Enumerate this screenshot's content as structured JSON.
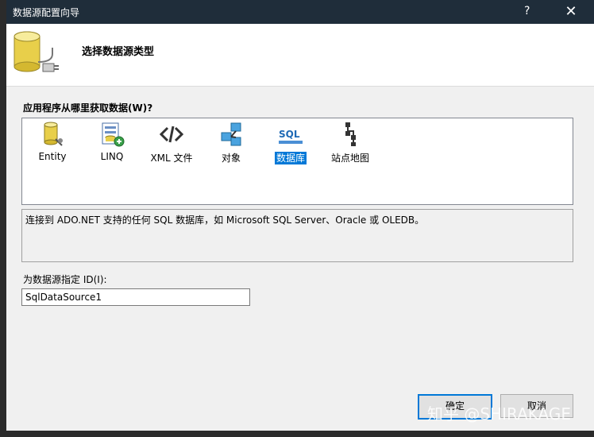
{
  "window": {
    "title": "数据源配置向导",
    "help_label": "?",
    "close_label": "✕"
  },
  "header": {
    "title": "选择数据源类型"
  },
  "question": {
    "label": "应用程序从哪里获取数据(W)?"
  },
  "types": [
    {
      "label": "Entity",
      "icon": "entity-database-icon"
    },
    {
      "label": "LINQ",
      "icon": "linq-icon"
    },
    {
      "label": "XML 文件",
      "icon": "xml-file-icon"
    },
    {
      "label": "对象",
      "icon": "object-icon"
    },
    {
      "label": "数据库",
      "icon": "sql-database-icon",
      "selected": true
    },
    {
      "label": "站点地图",
      "icon": "sitemap-icon"
    }
  ],
  "description": {
    "text": "连接到 ADO.NET 支持的任何 SQL 数据库，如 Microsoft SQL Server、Oracle 或 OLEDB。"
  },
  "id_field": {
    "label": "为数据源指定 ID(I):",
    "value": "SqlDataSource1"
  },
  "buttons": {
    "ok": "确定",
    "cancel": "取消"
  },
  "watermark": "知乎 @SHIRAKAGE",
  "colors": {
    "titlebar": "#1f2d3a",
    "accent": "#0078d7"
  }
}
